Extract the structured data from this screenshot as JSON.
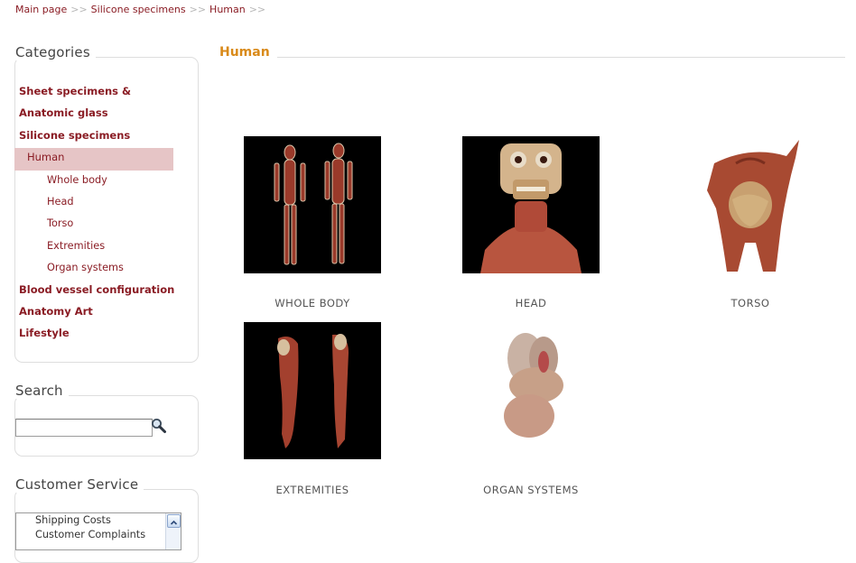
{
  "breadcrumb": {
    "items": [
      "Main page",
      "Silicone specimens",
      "Human"
    ],
    "separator": ">>"
  },
  "categories": {
    "title": "Categories",
    "items": [
      {
        "label": "Sheet specimens &",
        "level": 0
      },
      {
        "label": "Anatomic glass",
        "level": 0
      },
      {
        "label": "Silicone specimens",
        "level": 0
      },
      {
        "label": "Human",
        "level": 1,
        "selected": true
      },
      {
        "label": "Whole body",
        "level": 2
      },
      {
        "label": "Head",
        "level": 2
      },
      {
        "label": "Torso",
        "level": 2
      },
      {
        "label": "Extremities",
        "level": 2
      },
      {
        "label": "Organ systems",
        "level": 2
      },
      {
        "label": "Blood vessel configuration",
        "level": 0
      },
      {
        "label": "Anatomy Art",
        "level": 0
      },
      {
        "label": "Lifestyle",
        "level": 0
      }
    ]
  },
  "search": {
    "title": "Search",
    "value": "",
    "icon": "magnifier-icon"
  },
  "customer_service": {
    "title": "Customer Service",
    "items": [
      "Shipping Costs",
      "Customer Complaints"
    ]
  },
  "main": {
    "title": "Human",
    "products": [
      {
        "label": "WHOLE BODY",
        "image": "whole-body-specimen-image"
      },
      {
        "label": "HEAD",
        "image": "head-specimen-image"
      },
      {
        "label": "TORSO",
        "image": "torso-specimen-image"
      },
      {
        "label": "EXTREMITIES",
        "image": "extremities-specimen-image"
      },
      {
        "label": "ORGAN SYSTEMS",
        "image": "organ-systems-specimen-image"
      }
    ]
  },
  "colors": {
    "link": "#8a1c24",
    "selected_bg": "#e6c5c6",
    "heading_orange": "#d98a1a",
    "separator_gray": "#b8b8b8"
  }
}
